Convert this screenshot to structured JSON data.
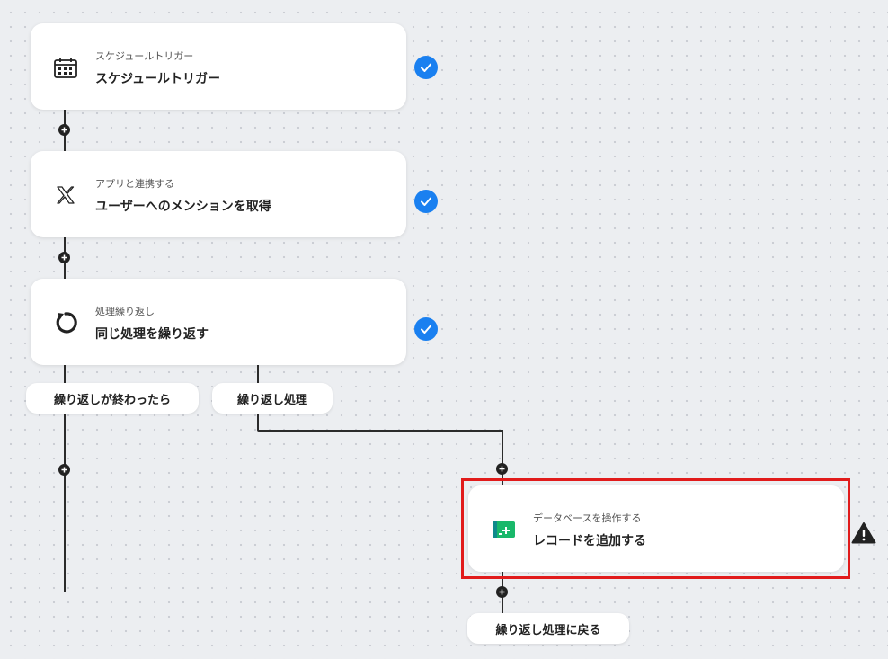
{
  "nodes": [
    {
      "subtitle": "スケジュールトリガー",
      "title": "スケジュールトリガー",
      "icon": "calendar-icon",
      "status": "completed"
    },
    {
      "subtitle": "アプリと連携する",
      "title": "ユーザーへのメンションを取得",
      "icon": "x-logo-icon",
      "status": "completed"
    },
    {
      "subtitle": "処理繰り返し",
      "title": "同じ処理を繰り返す",
      "icon": "loop-icon",
      "status": "completed"
    },
    {
      "subtitle": "データベースを操作する",
      "title": "レコードを追加する",
      "icon": "database-icon",
      "status": "warning"
    }
  ],
  "branches": {
    "after_loop": "繰り返しが終わったら",
    "loop_body": "繰り返し処理",
    "return_to_loop": "繰り返し処理に戻る"
  },
  "colors": {
    "check": "#1a80f0",
    "highlight": "#e11b1b",
    "database_icon": "#19b86a"
  }
}
